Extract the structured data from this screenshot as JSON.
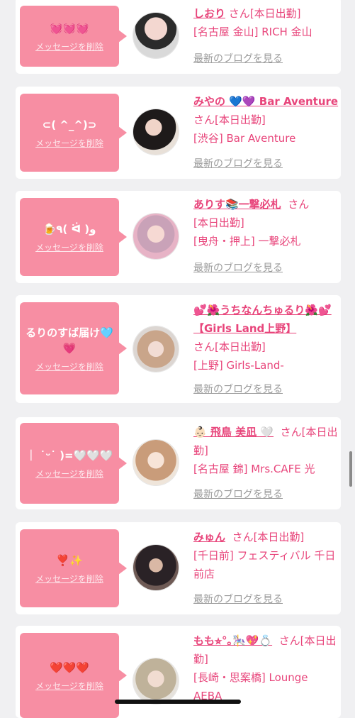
{
  "delete_label": "メッセージを削除",
  "blog_label": "最新のブログを見る",
  "colors": {
    "accent_pink": "#e8457b",
    "bubble_pink": "#f78ea3",
    "card_bg": "#ffffff",
    "page_bg": "#f0f0f2",
    "muted_gray": "#9a9a9a"
  },
  "cards": [
    {
      "message": "💓💓💓",
      "name": "しおり",
      "san": "さん",
      "status": "[本日出勤]",
      "location": "[名古屋 金山] RICH 金山",
      "avatar_icon": "profile-photo"
    },
    {
      "message": "⊂( ^_^)⊃",
      "name": "みやの 💙💜 Bar Aventure",
      "san": "さん",
      "status": "[本日出勤]",
      "location": "[渋谷] Bar Aventure",
      "avatar_icon": "profile-photo"
    },
    {
      "message": "🍺٩( ᐛ )و",
      "name": "ありす📚一撃必札",
      "san": "さん",
      "status": "[本日出勤]",
      "location": "[曳舟・押上] 一撃必札",
      "avatar_icon": "profile-photo"
    },
    {
      "message": "るりのすば届け🩵💗",
      "name": "💕🌺うちなんちゅるり🌺💕【Girls Land上野】",
      "san": "さん",
      "status": "[本日出勤]",
      "location": "[上野] Girls-Land-",
      "avatar_icon": "profile-photo"
    },
    {
      "message": "｜ ˙ᵕ˙ )=🤍🤍🤍",
      "name": "👶🏻 飛鳥 美凪 🤍",
      "san": "さん",
      "status": "[本日出勤]",
      "location": "[名古屋 錦] Mrs.CAFE 光",
      "avatar_icon": "profile-photo"
    },
    {
      "message": "❣️✨",
      "name": "みゅん",
      "san": "さん",
      "status": "[本日出勤]",
      "location": "[千日前] フェスティバル 千日前店",
      "avatar_icon": "profile-photo"
    },
    {
      "message": "❤️❤️❤️",
      "name": "もも⭐︎°｡🎠💖💍",
      "san": "さん",
      "status": "[本日出勤]",
      "location": "[長崎・思案橋] Lounge AEBA",
      "avatar_icon": "profile-photo"
    }
  ]
}
